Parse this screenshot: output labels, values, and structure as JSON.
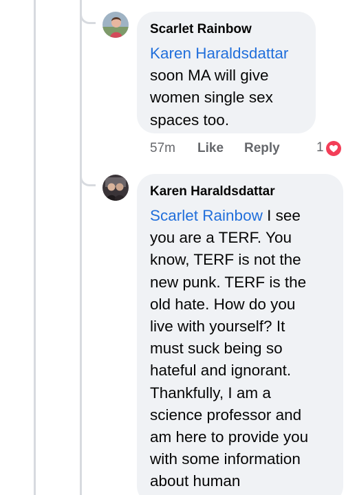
{
  "comments": [
    {
      "author": "Scarlet Rainbow",
      "mention": "Karen Haraldsdattar",
      "lines": [
        "soon MA will give",
        "women single sex",
        "spaces too."
      ],
      "avatar_icon": "user-avatar-icon",
      "actions": {
        "time": "57m",
        "like_label": "Like",
        "reply_label": "Reply"
      },
      "reactions": {
        "count": "1",
        "icon": "heart-reaction-icon",
        "color": "#f33e58"
      }
    },
    {
      "author": "Karen Haraldsdattar",
      "mention": "Scarlet Rainbow",
      "first_line_rest": " I see",
      "lines": [
        "you are a TERF. You",
        "know, TERF is not the",
        "new punk. TERF is the",
        "old hate. How do you",
        "live with yourself? It",
        "must suck being so",
        "hateful and ignorant.",
        "Thankfully, I am a",
        "science professor and",
        "am here to provide you",
        "with some information",
        "about human"
      ],
      "avatar_icon": "user-avatar-icon"
    }
  ],
  "colors": {
    "bubble_bg": "#f0f2f5",
    "mention": "#216fdb",
    "text": "#050505",
    "meta": "#65676b",
    "thread_line": "#d7dadf"
  }
}
